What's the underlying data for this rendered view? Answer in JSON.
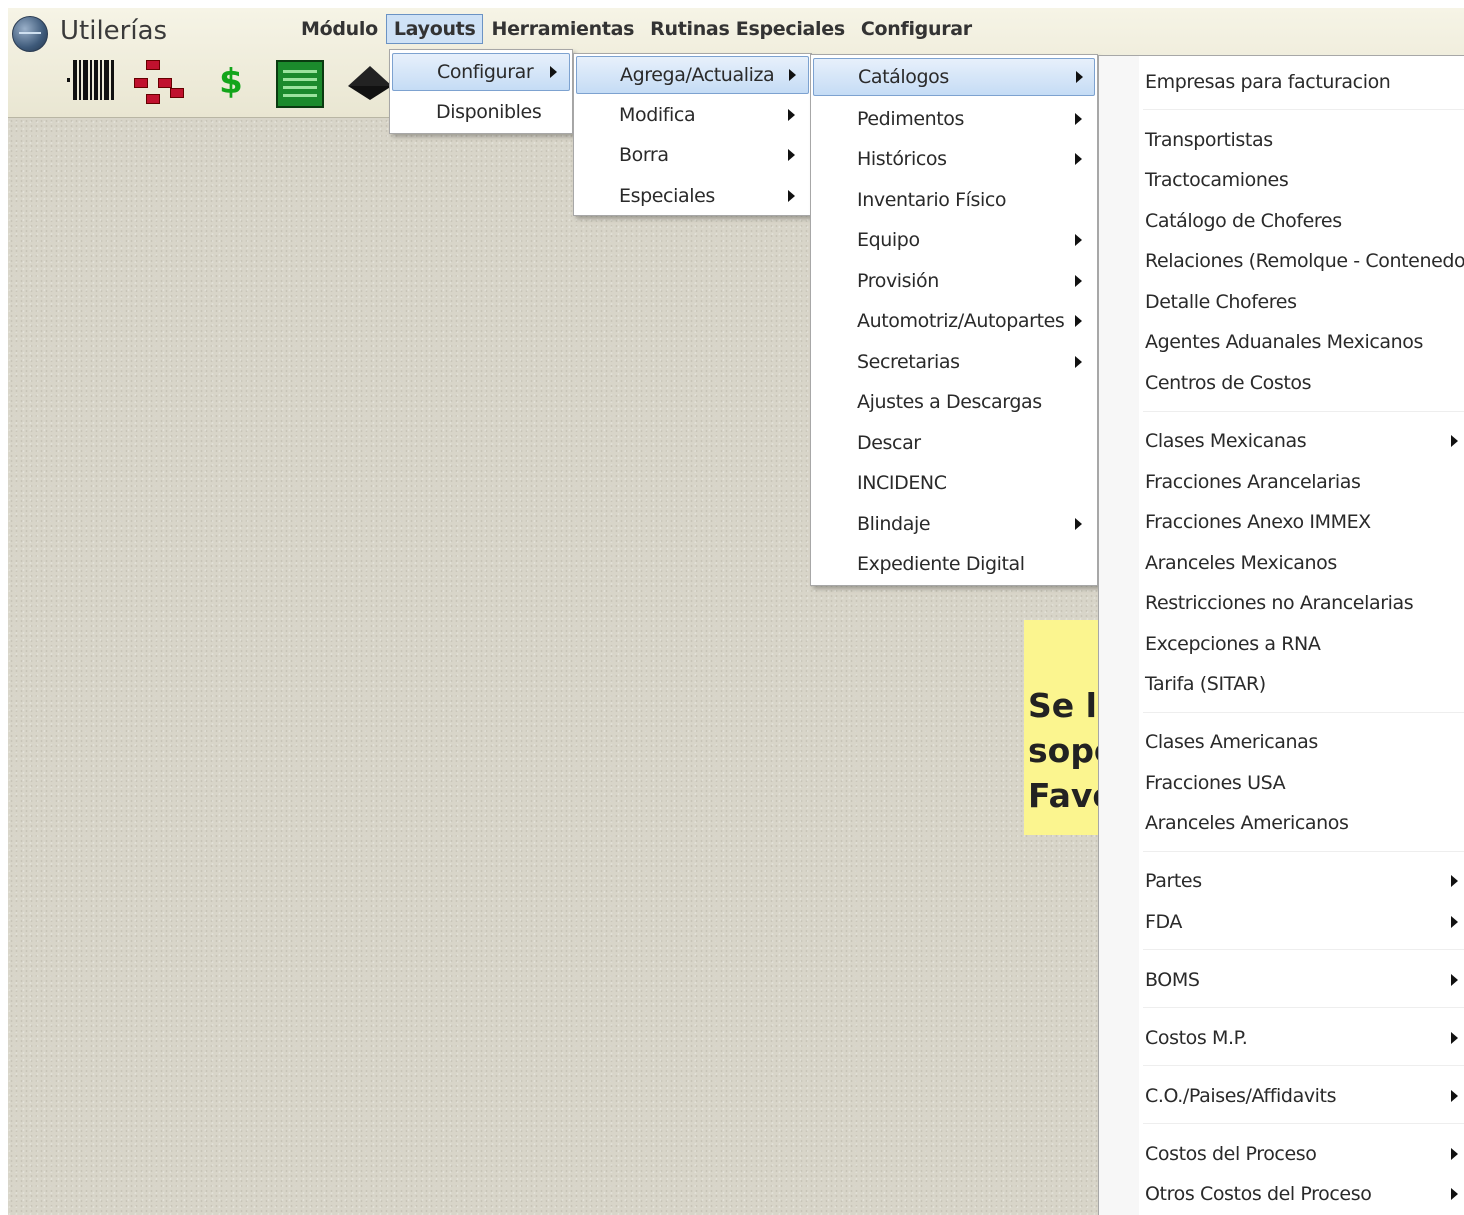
{
  "app": {
    "title": "Utilerías"
  },
  "menubar": [
    {
      "label": "Módulo",
      "active": false
    },
    {
      "label": "Layouts",
      "active": true
    },
    {
      "label": "Herramientas",
      "active": false
    },
    {
      "label": "Rutinas Especiales",
      "active": false
    },
    {
      "label": "Configurar",
      "active": false
    }
  ],
  "toolbar": {
    "icons": [
      "barcode-icon",
      "network-icon",
      "dollar-icon",
      "ledger-icon",
      "diamond-icon"
    ]
  },
  "note": {
    "lines": [
      "Se le",
      "sopo",
      "Favo"
    ]
  },
  "menu_layouts": [
    {
      "label": "Configurar",
      "submenu": true,
      "highlighted": true
    },
    {
      "label": "Disponibles",
      "submenu": false
    }
  ],
  "menu_configurar": [
    {
      "label": "Agrega/Actualiza",
      "submenu": true,
      "highlighted": true
    },
    {
      "label": "Modifica",
      "submenu": true
    },
    {
      "label": "Borra",
      "submenu": true
    },
    {
      "label": "Especiales",
      "submenu": true
    }
  ],
  "menu_agrega": [
    {
      "label": "Catálogos",
      "submenu": true,
      "highlighted": true
    },
    {
      "label": "Pedimentos",
      "submenu": true
    },
    {
      "label": "Históricos",
      "submenu": true
    },
    {
      "label": "Inventario Físico",
      "submenu": false
    },
    {
      "label": "Equipo",
      "submenu": true
    },
    {
      "label": "Provisión",
      "submenu": true
    },
    {
      "label": "Automotriz/Autopartes",
      "submenu": true
    },
    {
      "label": "Secretarias",
      "submenu": true
    },
    {
      "label": "Ajustes a Descargas",
      "submenu": false
    },
    {
      "label": "Descar",
      "submenu": false
    },
    {
      "label": "INCIDENC",
      "submenu": false
    },
    {
      "label": "Blindaje",
      "submenu": true
    },
    {
      "label": "Expediente Digital",
      "submenu": false
    }
  ],
  "menu_catalogos": [
    {
      "label": "Empresas para facturacion",
      "submenu": false
    },
    {
      "label": "Transportistas",
      "submenu": false
    },
    {
      "label": "Tractocamiones",
      "submenu": false
    },
    {
      "label": "Catálogo de Choferes",
      "submenu": false
    },
    {
      "label": "Relaciones (Remolque - Contenedor)",
      "submenu": false
    },
    {
      "label": "Detalle Choferes",
      "submenu": false
    },
    {
      "label": "Agentes Aduanales Mexicanos",
      "submenu": false
    },
    {
      "label": "Centros de Costos",
      "submenu": false
    },
    {
      "label": "Clases Mexicanas",
      "submenu": true
    },
    {
      "label": "Fracciones Arancelarias",
      "submenu": false
    },
    {
      "label": "Fracciones Anexo IMMEX",
      "submenu": false
    },
    {
      "label": "Aranceles Mexicanos",
      "submenu": false
    },
    {
      "label": "Restricciones no Arancelarias",
      "submenu": false
    },
    {
      "label": "Excepciones a RNA",
      "submenu": false
    },
    {
      "label": "Tarifa (SITAR)",
      "submenu": false
    },
    {
      "label": "Clases Americanas",
      "submenu": false
    },
    {
      "label": "Fracciones USA",
      "submenu": false
    },
    {
      "label": "Aranceles Americanos",
      "submenu": false
    },
    {
      "label": "Partes",
      "submenu": true
    },
    {
      "label": "FDA",
      "submenu": true
    },
    {
      "label": "BOMS",
      "submenu": true
    },
    {
      "label": "Costos M.P.",
      "submenu": true
    },
    {
      "label": "C.O./Paises/Affidavits",
      "submenu": true
    },
    {
      "label": "Costos del Proceso",
      "submenu": true
    },
    {
      "label": "Otros Costos del Proceso",
      "submenu": true
    }
  ]
}
